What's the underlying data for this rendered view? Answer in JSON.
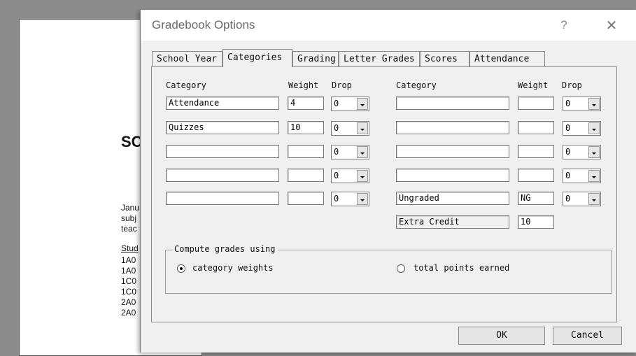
{
  "background_document": {
    "heading": "SC",
    "lines": [
      "Janu",
      "subj",
      "teac"
    ],
    "list_header": "Stud",
    "list_items": [
      "1A0",
      "1A0",
      "1C0",
      "1C0",
      "2A0",
      "2A0"
    ]
  },
  "dialog": {
    "title": "Gradebook Options",
    "help_icon": "?",
    "close_icon": "✕"
  },
  "tabs": [
    {
      "label": "School Year",
      "active": false
    },
    {
      "label": "Categories",
      "active": true
    },
    {
      "label": "Grading",
      "active": false
    },
    {
      "label": "Letter Grades",
      "active": false
    },
    {
      "label": "Scores",
      "active": false
    },
    {
      "label": "Attendance",
      "active": false
    }
  ],
  "headers": {
    "left_category": "Category",
    "left_weight": "Weight",
    "left_drop": "Drop",
    "right_category": "Category",
    "right_weight": "Weight",
    "right_drop": "Drop"
  },
  "left_rows": [
    {
      "category": "Attendance",
      "weight": "4",
      "drop": "0"
    },
    {
      "category": "Quizzes",
      "weight": "10",
      "drop": "0"
    },
    {
      "category": "",
      "weight": "",
      "drop": "0"
    },
    {
      "category": "",
      "weight": "",
      "drop": "0"
    },
    {
      "category": "",
      "weight": "",
      "drop": "0"
    }
  ],
  "right_rows": [
    {
      "category": "",
      "weight": "",
      "drop": "0"
    },
    {
      "category": "",
      "weight": "",
      "drop": "0"
    },
    {
      "category": "",
      "weight": "",
      "drop": "0"
    },
    {
      "category": "",
      "weight": "",
      "drop": "0"
    },
    {
      "category": "Ungraded",
      "weight": "NG",
      "drop": "0"
    }
  ],
  "extra_credit": {
    "label": "Extra Credit",
    "weight": "10"
  },
  "compute": {
    "group_title": "Compute grades using",
    "option_weights": "category weights",
    "option_points": "total points earned",
    "selected": "category weights"
  },
  "buttons": {
    "ok": "OK",
    "cancel": "Cancel"
  }
}
